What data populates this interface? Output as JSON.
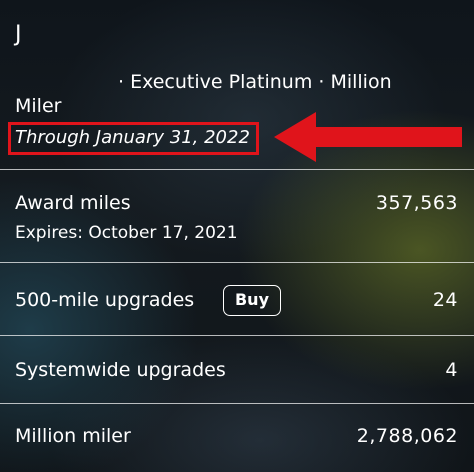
{
  "header": {
    "initial": "J",
    "status_line": "· Executive Platinum · Million",
    "status_line_cont": "Miler",
    "through": "Through January 31, 2022"
  },
  "rows": {
    "award_miles": {
      "label": "Award miles",
      "value": "357,563",
      "expires": "Expires: October 17, 2021"
    },
    "upgrades_500": {
      "label": "500-mile upgrades",
      "button": "Buy",
      "value": "24"
    },
    "systemwide": {
      "label": "Systemwide upgrades",
      "value": "4"
    },
    "million_miler": {
      "label": "Million miler",
      "value": "2,788,062"
    }
  },
  "colors": {
    "highlight": "#e0141b",
    "text": "#ffffff"
  },
  "icons": {
    "annotation_arrow": "left-arrow-icon"
  }
}
